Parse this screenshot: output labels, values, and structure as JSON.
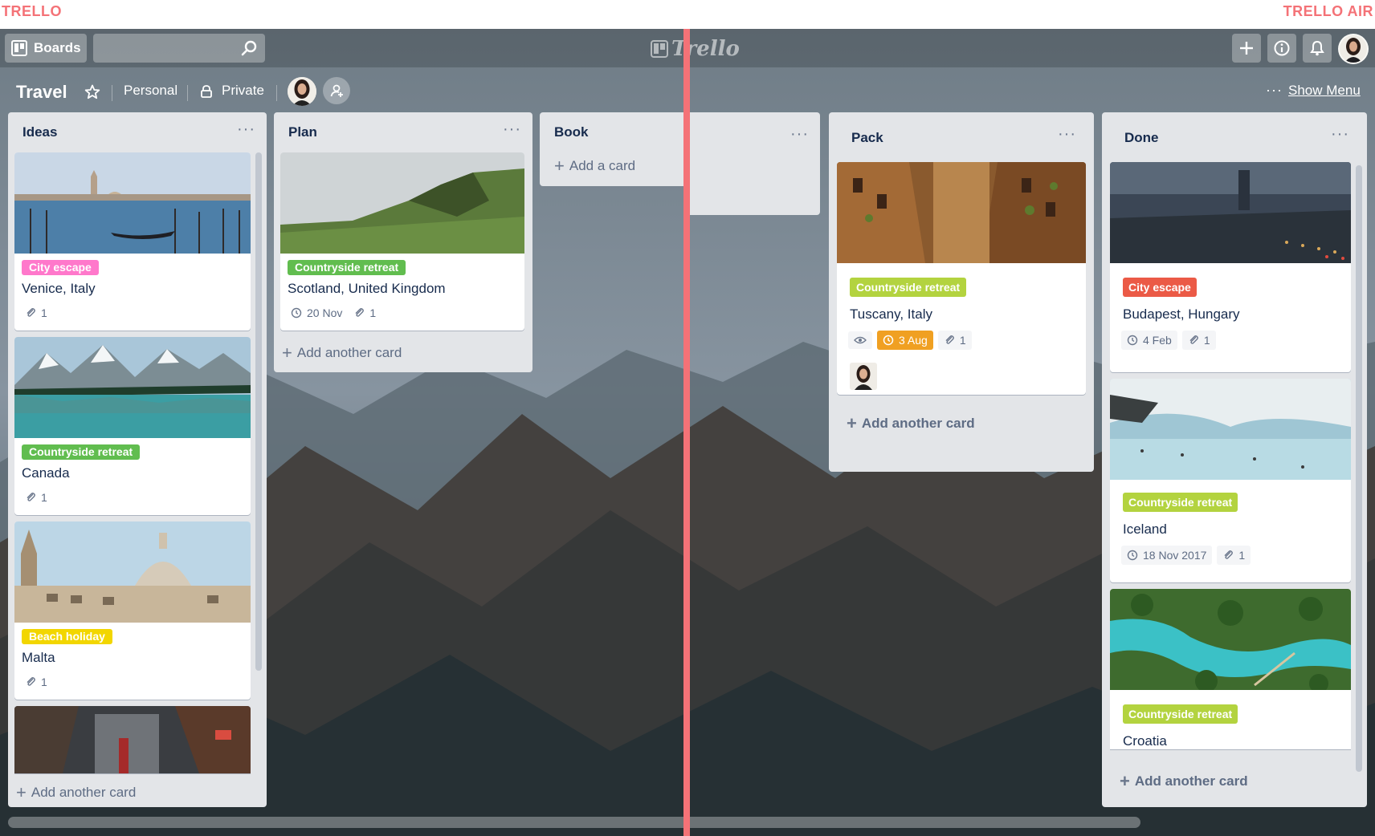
{
  "compare": {
    "left": "TRELLO",
    "right": "TRELLO AIR"
  },
  "topbar": {
    "boards_label": "Boards",
    "logo": "Trello"
  },
  "board": {
    "title": "Travel",
    "team": "Personal",
    "visibility": "Private",
    "menu_label": "Show Menu"
  },
  "lists": {
    "ideas": {
      "title": "Ideas",
      "add": "Add another card",
      "cards": [
        {
          "label": "City escape",
          "title": "Venice, Italy",
          "attachments": "1"
        },
        {
          "label": "Countryside retreat",
          "title": "Canada",
          "attachments": "1"
        },
        {
          "label": "Beach holiday",
          "title": "Malta",
          "attachments": "1"
        }
      ]
    },
    "plan": {
      "title": "Plan",
      "add": "Add another card",
      "cards": [
        {
          "label": "Countryside retreat",
          "title": "Scotland, United Kingdom",
          "due": "20 Nov",
          "attachments": "1"
        }
      ]
    },
    "book": {
      "title": "Book",
      "add": "Add a card"
    },
    "pack": {
      "title": "Pack",
      "add": "Add another card",
      "cards": [
        {
          "label": "Countryside retreat",
          "title": "Tuscany, Italy",
          "due": "3 Aug",
          "attachments": "1"
        }
      ]
    },
    "done": {
      "title": "Done",
      "add": "Add another card",
      "cards": [
        {
          "label": "City escape",
          "title": "Budapest, Hungary",
          "due": "4 Feb",
          "attachments": "1"
        },
        {
          "label": "Countryside retreat",
          "title": "Iceland",
          "due": "18 Nov 2017",
          "attachments": "1"
        },
        {
          "label": "Countryside retreat",
          "title": "Croatia"
        }
      ]
    }
  },
  "colors": {
    "accent_divider": "#f47277",
    "label_pink": "#ff78cb",
    "label_green": "#61bd4f",
    "label_yellow": "#f2d600",
    "label_red": "#eb5a46",
    "label_lime": "#b3d33f",
    "due_orange": "#f0a022"
  }
}
